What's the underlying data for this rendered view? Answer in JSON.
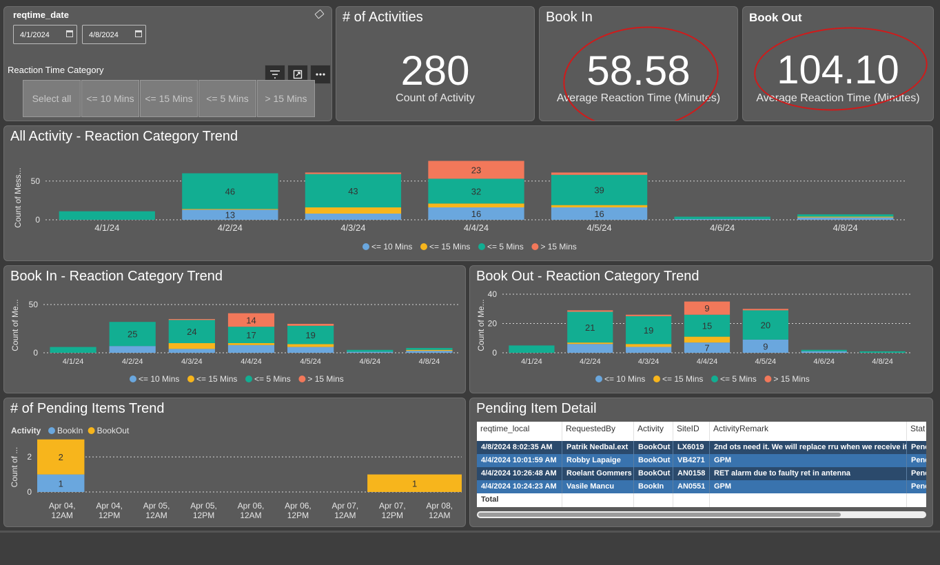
{
  "filters": {
    "date_label": "reqtime_date",
    "date_from": "4/1/2024",
    "date_to": "4/8/2024",
    "category_label": "Reaction Time Category",
    "category_buttons": [
      "Select all",
      "<= 10 Mins",
      "<= 15 Mins",
      "<= 5 Mins",
      "> 15 Mins"
    ]
  },
  "kpis": [
    {
      "title": "# of Activities",
      "value": "280",
      "label": "Count of Activity"
    },
    {
      "title": "Book In",
      "value": "58.58",
      "label": "Average Reaction Time (Minutes)"
    },
    {
      "title": "Book Out",
      "value": "104.10",
      "label": "Average Reaction Time (Minutes)"
    }
  ],
  "colors": {
    "le10": "#6aa7de",
    "le15": "#f7b51c",
    "le5": "#12ae92",
    "gt15": "#f2785a",
    "bookin": "#6aa7de",
    "bookout": "#f7b51c",
    "row_dark": "#2b4a6c",
    "row_light": "#3973ae"
  },
  "legend": [
    "<= 10 Mins",
    "<= 15 Mins",
    "<= 5 Mins",
    "> 15 Mins"
  ],
  "charts": {
    "all": {
      "title": "All Activity - Reaction Category Trend",
      "ylabel": "Count of Mess..."
    },
    "bookin": {
      "title": "Book In - Reaction Category Trend",
      "ylabel": "Count of Me..."
    },
    "bookout": {
      "title": "Book Out - Reaction Category Trend",
      "ylabel": "Count of Me..."
    },
    "pending": {
      "title": "# of Pending Items Trend",
      "ylabel": "Count of ...",
      "legend_title": "Activity",
      "legend": [
        "BookIn",
        "BookOut"
      ]
    }
  },
  "chart_data": [
    {
      "type": "bar",
      "title": "All Activity - Reaction Category Trend",
      "ylabel": "Count of Mess...",
      "categories": [
        "4/1/24",
        "4/2/24",
        "4/3/24",
        "4/4/24",
        "4/5/24",
        "4/6/24",
        "4/8/24"
      ],
      "yticks": [
        0,
        50
      ],
      "ylim": [
        0,
        80
      ],
      "series": [
        {
          "name": "<= 10 Mins",
          "values": [
            0,
            13,
            8,
            16,
            16,
            1,
            3
          ]
        },
        {
          "name": "<= 15 Mins",
          "values": [
            0,
            1,
            8,
            5,
            3,
            0,
            1
          ]
        },
        {
          "name": "<= 5 Mins",
          "values": [
            11,
            46,
            43,
            32,
            39,
            3,
            3
          ]
        },
        {
          "name": "> 15 Mins",
          "values": [
            0,
            0,
            2,
            23,
            3,
            0,
            0
          ]
        }
      ],
      "labels": [
        {
          "cat": 1,
          "series": 0,
          "text": "13"
        },
        {
          "cat": 1,
          "series": 2,
          "text": "46"
        },
        {
          "cat": 2,
          "series": 2,
          "text": "43"
        },
        {
          "cat": 3,
          "series": 0,
          "text": "16"
        },
        {
          "cat": 3,
          "series": 2,
          "text": "32"
        },
        {
          "cat": 3,
          "series": 3,
          "text": "23"
        },
        {
          "cat": 4,
          "series": 0,
          "text": "16"
        },
        {
          "cat": 4,
          "series": 2,
          "text": "39"
        }
      ]
    },
    {
      "type": "bar",
      "title": "Book In - Reaction Category Trend",
      "ylabel": "Count of Me...",
      "categories": [
        "4/1/24",
        "4/2/24",
        "4/3/24",
        "4/4/24",
        "4/5/24",
        "4/6/24",
        "4/8/24"
      ],
      "yticks": [
        0,
        50
      ],
      "ylim": [
        0,
        60
      ],
      "series": [
        {
          "name": "<= 10 Mins",
          "values": [
            0,
            7,
            4,
            8,
            6,
            1,
            2
          ]
        },
        {
          "name": "<= 15 Mins",
          "values": [
            0,
            0,
            6,
            2,
            3,
            0,
            1
          ]
        },
        {
          "name": "<= 5 Mins",
          "values": [
            6,
            25,
            24,
            17,
            19,
            2,
            2
          ]
        },
        {
          "name": "> 15 Mins",
          "values": [
            0,
            0,
            1,
            14,
            2,
            0,
            0
          ]
        }
      ],
      "labels": [
        {
          "cat": 1,
          "series": 2,
          "text": "25"
        },
        {
          "cat": 2,
          "series": 2,
          "text": "24"
        },
        {
          "cat": 3,
          "series": 2,
          "text": "17"
        },
        {
          "cat": 3,
          "series": 3,
          "text": "14"
        },
        {
          "cat": 4,
          "series": 2,
          "text": "19"
        }
      ]
    },
    {
      "type": "bar",
      "title": "Book Out - Reaction Category Trend",
      "ylabel": "Count of Me...",
      "categories": [
        "4/1/24",
        "4/2/24",
        "4/3/24",
        "4/4/24",
        "4/5/24",
        "4/6/24",
        "4/8/24"
      ],
      "yticks": [
        0,
        20,
        40
      ],
      "ylim": [
        0,
        40
      ],
      "series": [
        {
          "name": "<= 10 Mins",
          "values": [
            0,
            6,
            4,
            7,
            9,
            1,
            0
          ]
        },
        {
          "name": "<= 15 Mins",
          "values": [
            0,
            1,
            2,
            4,
            0,
            0,
            0
          ]
        },
        {
          "name": "<= 5 Mins",
          "values": [
            5,
            21,
            19,
            15,
            20,
            1,
            1
          ]
        },
        {
          "name": "> 15 Mins",
          "values": [
            0,
            1,
            1,
            9,
            1,
            0,
            0
          ]
        }
      ],
      "labels": [
        {
          "cat": 1,
          "series": 2,
          "text": "21"
        },
        {
          "cat": 2,
          "series": 2,
          "text": "19"
        },
        {
          "cat": 3,
          "series": 0,
          "text": "7"
        },
        {
          "cat": 3,
          "series": 2,
          "text": "15"
        },
        {
          "cat": 3,
          "series": 3,
          "text": "9"
        },
        {
          "cat": 4,
          "series": 0,
          "text": "9"
        },
        {
          "cat": 4,
          "series": 2,
          "text": "20"
        }
      ]
    },
    {
      "type": "bar",
      "title": "# of Pending Items Trend",
      "ylabel": "Count of ...",
      "categories": [
        "Apr 04, 12AM",
        "Apr 04, 12PM",
        "Apr 05, 12AM",
        "Apr 05, 12PM",
        "Apr 06, 12AM",
        "Apr 06, 12PM",
        "Apr 07, 12AM",
        "Apr 07, 12PM",
        "Apr 08, 12AM"
      ],
      "yticks": [
        0,
        2
      ],
      "ylim": [
        0,
        3.5
      ],
      "series": [
        {
          "name": "BookIn",
          "bars": [
            {
              "from": 0,
              "to": 1,
              "value": 1
            }
          ]
        },
        {
          "name": "BookOut",
          "bars": [
            {
              "from": 0,
              "to": 1,
              "value": 2
            },
            {
              "from": 7,
              "to": 9,
              "value": 1
            }
          ]
        }
      ]
    }
  ],
  "table": {
    "title": "Pending Item Detail",
    "columns": [
      "reqtime_local",
      "RequestedBy",
      "Activity",
      "SiteID",
      "ActivityRemark",
      "Stat"
    ],
    "rows": [
      [
        "4/8/2024 8:02:35 AM",
        "Patrik Nedbal.ext",
        "BookOut",
        "LX6019",
        "2nd ots need it. We will replace rru when we receive it.",
        "Penc"
      ],
      [
        "4/4/2024 10:01:59 AM",
        "Robby Lapaige",
        "BookOut",
        "VB4271",
        "GPM",
        "Penc"
      ],
      [
        "4/4/2024 10:26:48 AM",
        "Roelant Gommers",
        "BookOut",
        "AN0158",
        "RET alarm due to faulty ret in antenna",
        "Penc"
      ],
      [
        "4/4/2024 10:24:23 AM",
        "Vasile Mancu",
        "BookIn",
        "AN0551",
        "GPM",
        "Penc"
      ]
    ],
    "total_label": "Total"
  }
}
